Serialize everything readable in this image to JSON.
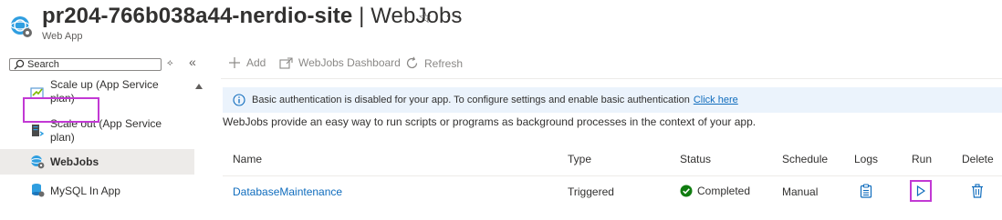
{
  "header": {
    "resource_name": "pr204-766b038a44-nerdio-site",
    "separator": "|",
    "page_name": "WebJobs",
    "subtitle": "Web App",
    "favorite_glyph": "☆",
    "more_glyph": "···"
  },
  "sidebar": {
    "search_placeholder": "Search",
    "items": [
      {
        "label_line1": "Scale up (App Service",
        "label_line2": "plan)",
        "icon": "scale-up-icon"
      },
      {
        "label_line1": "Scale out (App Service",
        "label_line2": "plan)",
        "icon": "scale-out-icon"
      },
      {
        "label_line1": "WebJobs",
        "label_line2": "",
        "icon": "webjobs-icon",
        "selected": true
      },
      {
        "label_line1": "MySQL In App",
        "label_line2": "",
        "icon": "mysql-icon"
      }
    ]
  },
  "toolbar": {
    "add_label": "Add",
    "dashboard_label": "WebJobs Dashboard",
    "refresh_label": "Refresh"
  },
  "info": {
    "text": "Basic authentication is disabled for your app. To configure settings and enable basic authentication",
    "link": "Click here"
  },
  "description": "WebJobs provide an easy way to run scripts or programs as background processes in the context of your app.",
  "table": {
    "columns": [
      "Name",
      "Type",
      "Status",
      "Schedule",
      "Logs",
      "Run",
      "Delete"
    ],
    "rows": [
      {
        "name": "DatabaseMaintenance",
        "type": "Triggered",
        "status": "Completed",
        "schedule": "Manual"
      }
    ]
  },
  "colors": {
    "accent": "#0f6cbd",
    "success": "#107c10",
    "highlight_outline": "#c239d4",
    "info_bg": "#ebf3fc"
  }
}
